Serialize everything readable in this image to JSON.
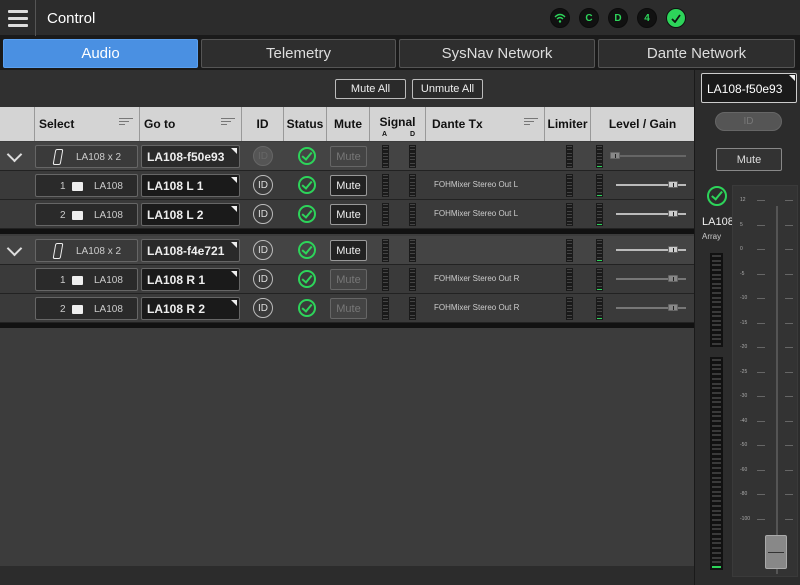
{
  "header": {
    "title": "Control"
  },
  "status_icons": [
    {
      "name": "wifi-icon",
      "label": ""
    },
    {
      "name": "status-c-icon",
      "label": "C"
    },
    {
      "name": "status-d-icon",
      "label": "D"
    },
    {
      "name": "status-4-icon",
      "label": "4"
    },
    {
      "name": "ok-check-icon",
      "label": ""
    }
  ],
  "tabs": [
    {
      "label": "Audio",
      "active": true
    },
    {
      "label": "Telemetry",
      "active": false
    },
    {
      "label": "SysNav Network",
      "active": false
    },
    {
      "label": "Dante Network",
      "active": false
    }
  ],
  "toolbar": {
    "mute_all": "Mute All",
    "unmute_all": "Unmute All"
  },
  "columns": {
    "select": "Select",
    "goto": "Go to",
    "id": "ID",
    "status": "Status",
    "mute": "Mute",
    "signal": "Signal",
    "signal_a": "A",
    "signal_d": "D",
    "dante_tx": "Dante Tx",
    "limiter": "Limiter",
    "level_gain": "Level / Gain"
  },
  "groups": [
    {
      "select_label": "LA108 x 2",
      "goto": "LA108-f50e93",
      "id_label": "ID",
      "mute_label": "Mute",
      "children": [
        {
          "index": "1",
          "model": "LA108",
          "goto": "LA108 L 1",
          "id_label": "ID",
          "mute_label": "Mute",
          "dante_tx": "FOHMixer Stereo Out L"
        },
        {
          "index": "2",
          "model": "LA108",
          "goto": "LA108 L 2",
          "id_label": "ID",
          "mute_label": "Mute",
          "dante_tx": "FOHMixer Stereo Out L"
        }
      ]
    },
    {
      "select_label": "LA108 x 2",
      "goto": "LA108-f4e721",
      "id_label": "ID",
      "mute_label": "Mute",
      "children": [
        {
          "index": "1",
          "model": "LA108",
          "goto": "LA108 R 1",
          "id_label": "ID",
          "mute_label": "Mute",
          "dante_tx": "FOHMixer Stereo Out R"
        },
        {
          "index": "2",
          "model": "LA108",
          "goto": "LA108 R 2",
          "id_label": "ID",
          "mute_label": "Mute",
          "dante_tx": "FOHMixer Stereo Out R"
        }
      ]
    }
  ],
  "right_panel": {
    "device": "LA108-f50e93",
    "id_label": "ID",
    "mute_label": "Mute",
    "model": "LA108",
    "type": "Array",
    "fader_scale": [
      "12",
      "5",
      "0",
      "-5",
      "-10",
      "-15",
      "-20",
      "-25",
      "-30",
      "-40",
      "-50",
      "-60",
      "-80",
      "-100"
    ]
  },
  "colors": {
    "accent": "#4a90e2",
    "ok": "#2dd45a"
  }
}
